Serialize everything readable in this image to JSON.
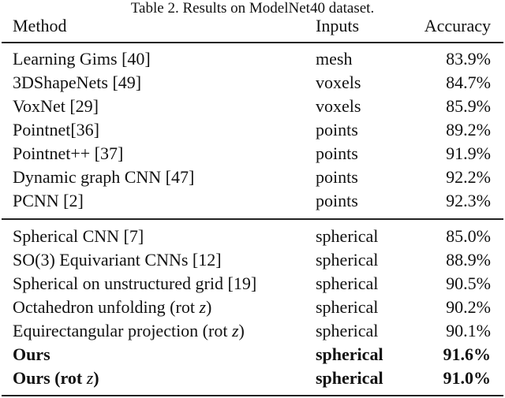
{
  "caption": "Table 2. Results on ModelNet40 dataset.",
  "columns": {
    "method": "Method",
    "inputs": "Inputs",
    "accuracy": "Accuracy"
  },
  "group1": [
    {
      "method": "Learning Gims [40]",
      "inputs": "mesh",
      "accuracy": "83.9%"
    },
    {
      "method": "3DShapeNets [49]",
      "inputs": "voxels",
      "accuracy": "84.7%"
    },
    {
      "method": "VoxNet [29]",
      "inputs": "voxels",
      "accuracy": "85.9%"
    },
    {
      "method": "Pointnet[36]",
      "inputs": "points",
      "accuracy": "89.2%"
    },
    {
      "method": "Pointnet++ [37]",
      "inputs": "points",
      "accuracy": "91.9%"
    },
    {
      "method": "Dynamic graph CNN [47]",
      "inputs": "points",
      "accuracy": "92.2%"
    },
    {
      "method": "PCNN [2]",
      "inputs": "points",
      "accuracy": "92.3%"
    }
  ],
  "group2": [
    {
      "method": "Spherical CNN [7]",
      "inputs": "spherical",
      "accuracy": "85.0%"
    },
    {
      "method": "SO(3) Equivariant CNNs [12]",
      "inputs": "spherical",
      "accuracy": "88.9%"
    },
    {
      "method": "Spherical on unstructured grid [19]",
      "inputs": "spherical",
      "accuracy": "90.5%"
    },
    {
      "method_prefix": "Octahedron unfolding (rot ",
      "method_var": "z",
      "method_suffix": ")",
      "inputs": "spherical",
      "accuracy": "90.2%"
    },
    {
      "method_prefix": "Equirectangular projection (rot ",
      "method_var": "z",
      "method_suffix": ")",
      "inputs": "spherical",
      "accuracy": "90.1%"
    },
    {
      "method": "Ours",
      "inputs": "spherical",
      "accuracy": "91.6%",
      "bold": true
    },
    {
      "method_prefix": "Ours (rot ",
      "method_var": "z",
      "method_suffix": ")",
      "inputs": "spherical",
      "accuracy": "91.0%",
      "bold": true
    }
  ]
}
